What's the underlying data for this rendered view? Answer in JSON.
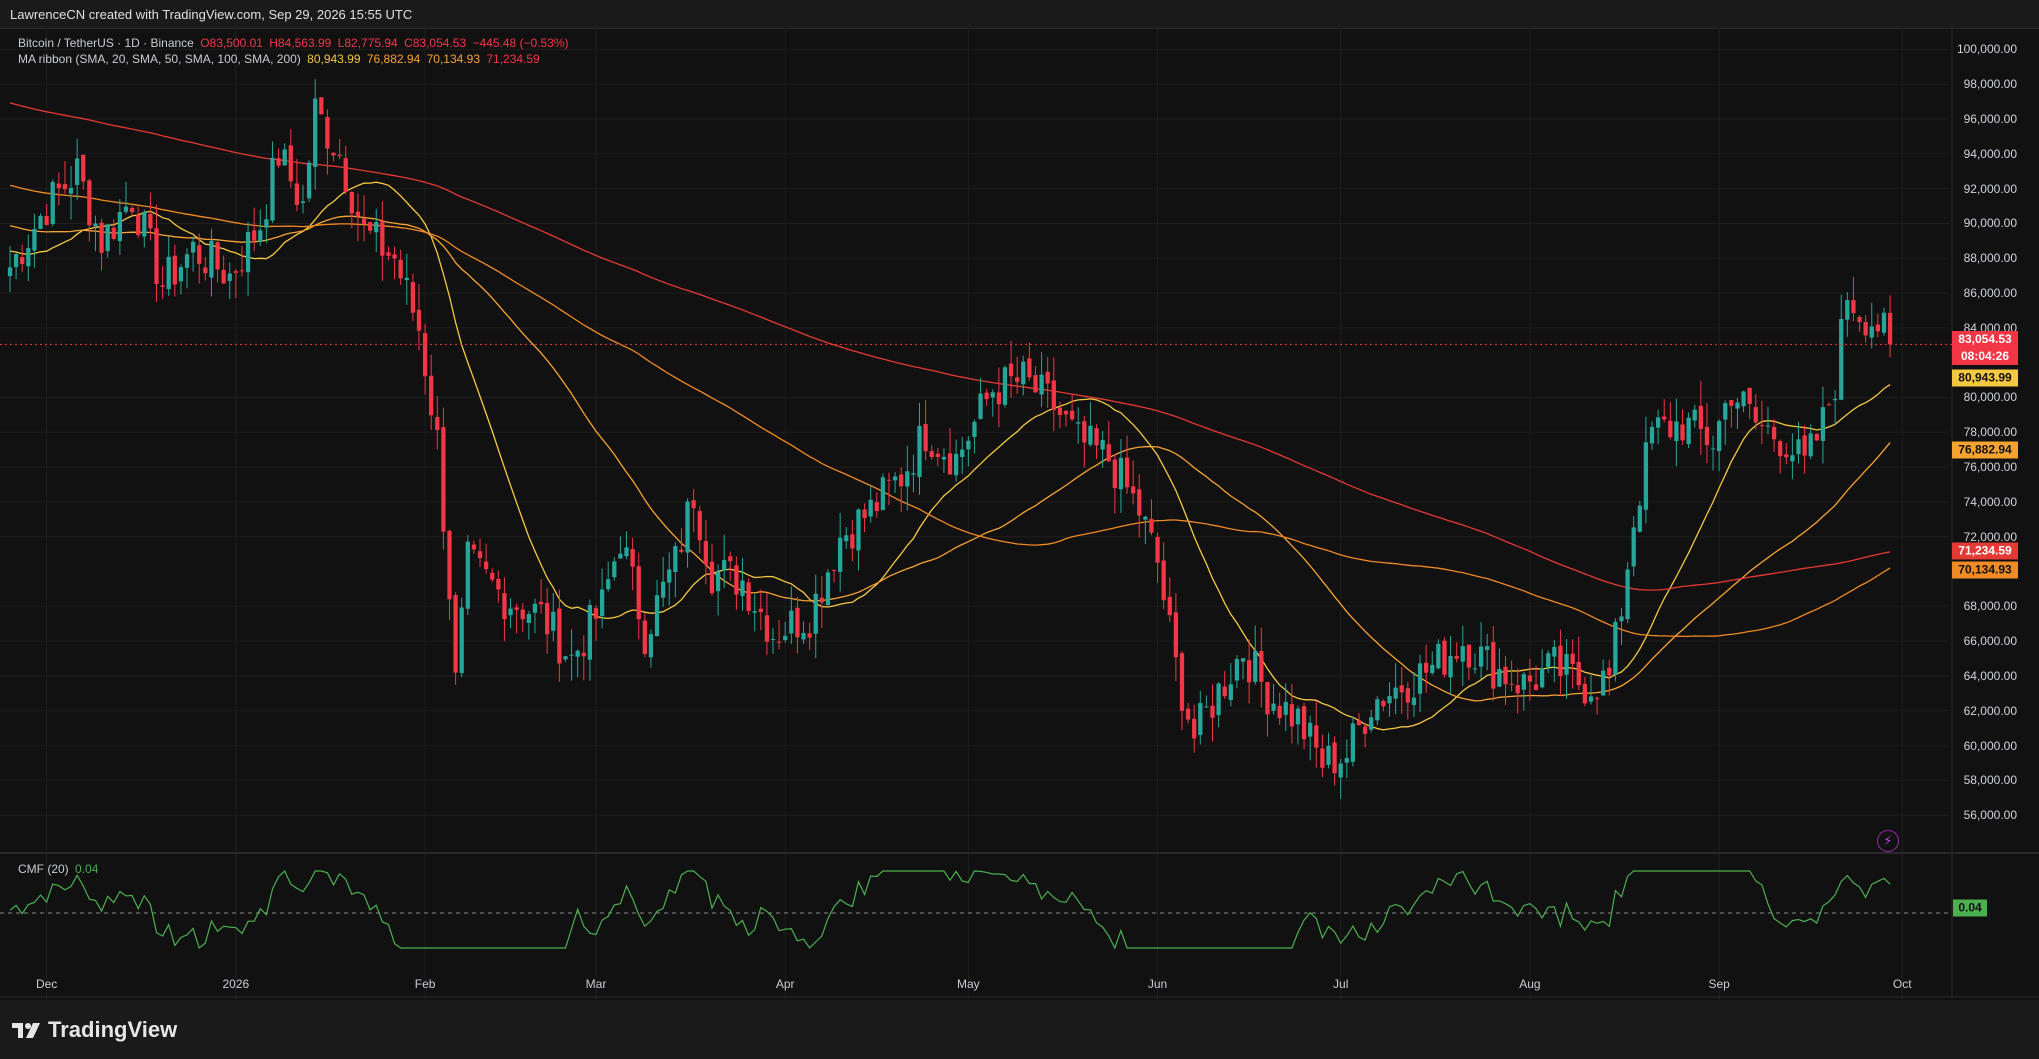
{
  "header": {
    "text": "LawrenceCN created with TradingView.com, Sep 29, 2026 15:55 UTC"
  },
  "legend": {
    "symbol": "Bitcoin / TetherUS · 1D · Binance",
    "o": "O83,500.01",
    "h": "H84,563.99",
    "l": "L82,775.94",
    "c": "C83,054.53",
    "chg": "−445.48 (−0.53%)",
    "ma_name": "MA ribbon (SMA, 20, SMA, 50, SMA, 100, SMA, 200)",
    "ma1": "80,943.99",
    "ma2": "76,882.94",
    "ma3": "70,134.93",
    "ma4": "71,234.59",
    "cmf_name": "CMF (20)",
    "cmf_value": "0.04"
  },
  "price_axis": {
    "labels": [
      "100,000.00",
      "98,000.00",
      "96,000.00",
      "94,000.00",
      "92,000.00",
      "90,000.00",
      "88,000.00",
      "86,000.00",
      "84,000.00",
      "80,000.00",
      "78,000.00",
      "76,000.00",
      "74,000.00",
      "72,000.00",
      "68,000.00",
      "66,000.00",
      "64,000.00",
      "62,000.00",
      "60,000.00",
      "58,000.00",
      "56,000.00"
    ],
    "values": [
      100000,
      98000,
      96000,
      94000,
      92000,
      90000,
      88000,
      86000,
      84000,
      80000,
      78000,
      76000,
      74000,
      72000,
      68000,
      66000,
      64000,
      62000,
      60000,
      58000,
      56000
    ]
  },
  "tags": {
    "last_price": "83,054.53",
    "countdown": "08:04:26",
    "sma20": "80,943.99",
    "sma50": "76,882.94",
    "sma200": "71,234.59",
    "sma100": "70,134.93",
    "cmf": "0.04"
  },
  "time_axis": {
    "labels": [
      "Dec",
      "2026",
      "Feb",
      "Mar",
      "Apr",
      "May",
      "Jun",
      "Jul",
      "Aug",
      "Sep",
      "Oct"
    ]
  },
  "footer": {
    "brand": "TradingView"
  },
  "colors": {
    "up": "#26a69a",
    "down": "#f23645",
    "sma20": "#f5c842",
    "sma50": "#f7a332",
    "sma100": "#f08a24",
    "sma200": "#e53935",
    "cmf": "#4caf50",
    "background": "#111111"
  },
  "chart_data": {
    "type": "candlestick",
    "title": "Bitcoin / TetherUS · 1D · Binance",
    "ylim": [
      54000,
      101000
    ],
    "x_ticks": [
      "Dec",
      "2026",
      "Feb",
      "Mar",
      "Apr",
      "May",
      "Jun",
      "Jul",
      "Aug",
      "Sep",
      "Oct"
    ],
    "price_path": [
      {
        "date": "2025-11-25",
        "close": 87500
      },
      {
        "date": "2025-12-01",
        "close": 91000
      },
      {
        "date": "2025-12-06",
        "close": 93000
      },
      {
        "date": "2025-12-10",
        "close": 89000
      },
      {
        "date": "2025-12-15",
        "close": 91500
      },
      {
        "date": "2025-12-20",
        "close": 86500
      },
      {
        "date": "2025-12-25",
        "close": 88500
      },
      {
        "date": "2025-12-31",
        "close": 87000
      },
      {
        "date": "2026-01-05",
        "close": 90000
      },
      {
        "date": "2026-01-08",
        "close": 94000
      },
      {
        "date": "2026-01-12",
        "close": 91000
      },
      {
        "date": "2026-01-14",
        "close": 96500
      },
      {
        "date": "2026-01-18",
        "close": 94000
      },
      {
        "date": "2026-01-22",
        "close": 89500
      },
      {
        "date": "2026-01-27",
        "close": 88000
      },
      {
        "date": "2026-01-31",
        "close": 84000
      },
      {
        "date": "2026-02-03",
        "close": 77500
      },
      {
        "date": "2026-02-05",
        "close": 69000
      },
      {
        "date": "2026-02-06",
        "close": 63500
      },
      {
        "date": "2026-02-08",
        "close": 70500
      },
      {
        "date": "2026-02-14",
        "close": 68500
      },
      {
        "date": "2026-02-20",
        "close": 67500
      },
      {
        "date": "2026-02-25",
        "close": 65000
      },
      {
        "date": "2026-03-02",
        "close": 68000
      },
      {
        "date": "2026-03-05",
        "close": 72000
      },
      {
        "date": "2026-03-09",
        "close": 66500
      },
      {
        "date": "2026-03-14",
        "close": 70500
      },
      {
        "date": "2026-03-17",
        "close": 74500
      },
      {
        "date": "2026-03-20",
        "close": 70000
      },
      {
        "date": "2026-03-25",
        "close": 69500
      },
      {
        "date": "2026-03-30",
        "close": 66500
      },
      {
        "date": "2026-04-05",
        "close": 67500
      },
      {
        "date": "2026-04-10",
        "close": 72000
      },
      {
        "date": "2026-04-15",
        "close": 73500
      },
      {
        "date": "2026-04-20",
        "close": 75500
      },
      {
        "date": "2026-04-24",
        "close": 78000
      },
      {
        "date": "2026-04-29",
        "close": 76500
      },
      {
        "date": "2026-05-05",
        "close": 80500
      },
      {
        "date": "2026-05-10",
        "close": 81000
      },
      {
        "date": "2026-05-15",
        "close": 79500
      },
      {
        "date": "2026-05-19",
        "close": 77500
      },
      {
        "date": "2026-05-24",
        "close": 76500
      },
      {
        "date": "2026-05-29",
        "close": 73500
      },
      {
        "date": "2026-06-01",
        "close": 70500
      },
      {
        "date": "2026-06-04",
        "close": 64500
      },
      {
        "date": "2026-06-07",
        "close": 60500
      },
      {
        "date": "2026-06-10",
        "close": 62500
      },
      {
        "date": "2026-06-15",
        "close": 65500
      },
      {
        "date": "2026-06-19",
        "close": 63000
      },
      {
        "date": "2026-06-24",
        "close": 61500
      },
      {
        "date": "2026-06-28",
        "close": 59000
      },
      {
        "date": "2026-07-02",
        "close": 59500
      },
      {
        "date": "2026-07-06",
        "close": 62500
      },
      {
        "date": "2026-07-11",
        "close": 63500
      },
      {
        "date": "2026-07-16",
        "close": 64500
      },
      {
        "date": "2026-07-21",
        "close": 66000
      },
      {
        "date": "2026-07-26",
        "close": 64500
      },
      {
        "date": "2026-07-31",
        "close": 63500
      },
      {
        "date": "2026-08-05",
        "close": 64500
      },
      {
        "date": "2026-08-10",
        "close": 63500
      },
      {
        "date": "2026-08-14",
        "close": 63800
      },
      {
        "date": "2026-08-16",
        "close": 68000
      },
      {
        "date": "2026-08-18",
        "close": 73000
      },
      {
        "date": "2026-08-21",
        "close": 78000
      },
      {
        "date": "2026-08-26",
        "close": 78500
      },
      {
        "date": "2026-08-31",
        "close": 77500
      },
      {
        "date": "2026-09-03",
        "close": 80500
      },
      {
        "date": "2026-09-07",
        "close": 78500
      },
      {
        "date": "2026-09-12",
        "close": 77500
      },
      {
        "date": "2026-09-15",
        "close": 76000
      },
      {
        "date": "2026-09-18",
        "close": 78500
      },
      {
        "date": "2026-09-20",
        "close": 81000
      },
      {
        "date": "2026-09-22",
        "close": 86000
      },
      {
        "date": "2026-09-24",
        "close": 85000
      },
      {
        "date": "2026-09-27",
        "close": 84200
      },
      {
        "date": "2026-09-29",
        "close": 83054.53
      }
    ],
    "series": [
      {
        "name": "SMA 20",
        "end_value": 80943.99
      },
      {
        "name": "SMA 50",
        "end_value": 76882.94
      },
      {
        "name": "SMA 100",
        "end_value": 70134.93
      },
      {
        "name": "SMA 200",
        "end_value": 71234.59
      }
    ],
    "last": {
      "open": 83500.01,
      "high": 84563.99,
      "low": 82775.94,
      "close": 83054.53,
      "change": -445.48,
      "change_pct": -0.53
    },
    "indicator": {
      "name": "CMF (20)",
      "last": 0.04
    },
    "grid": true
  }
}
